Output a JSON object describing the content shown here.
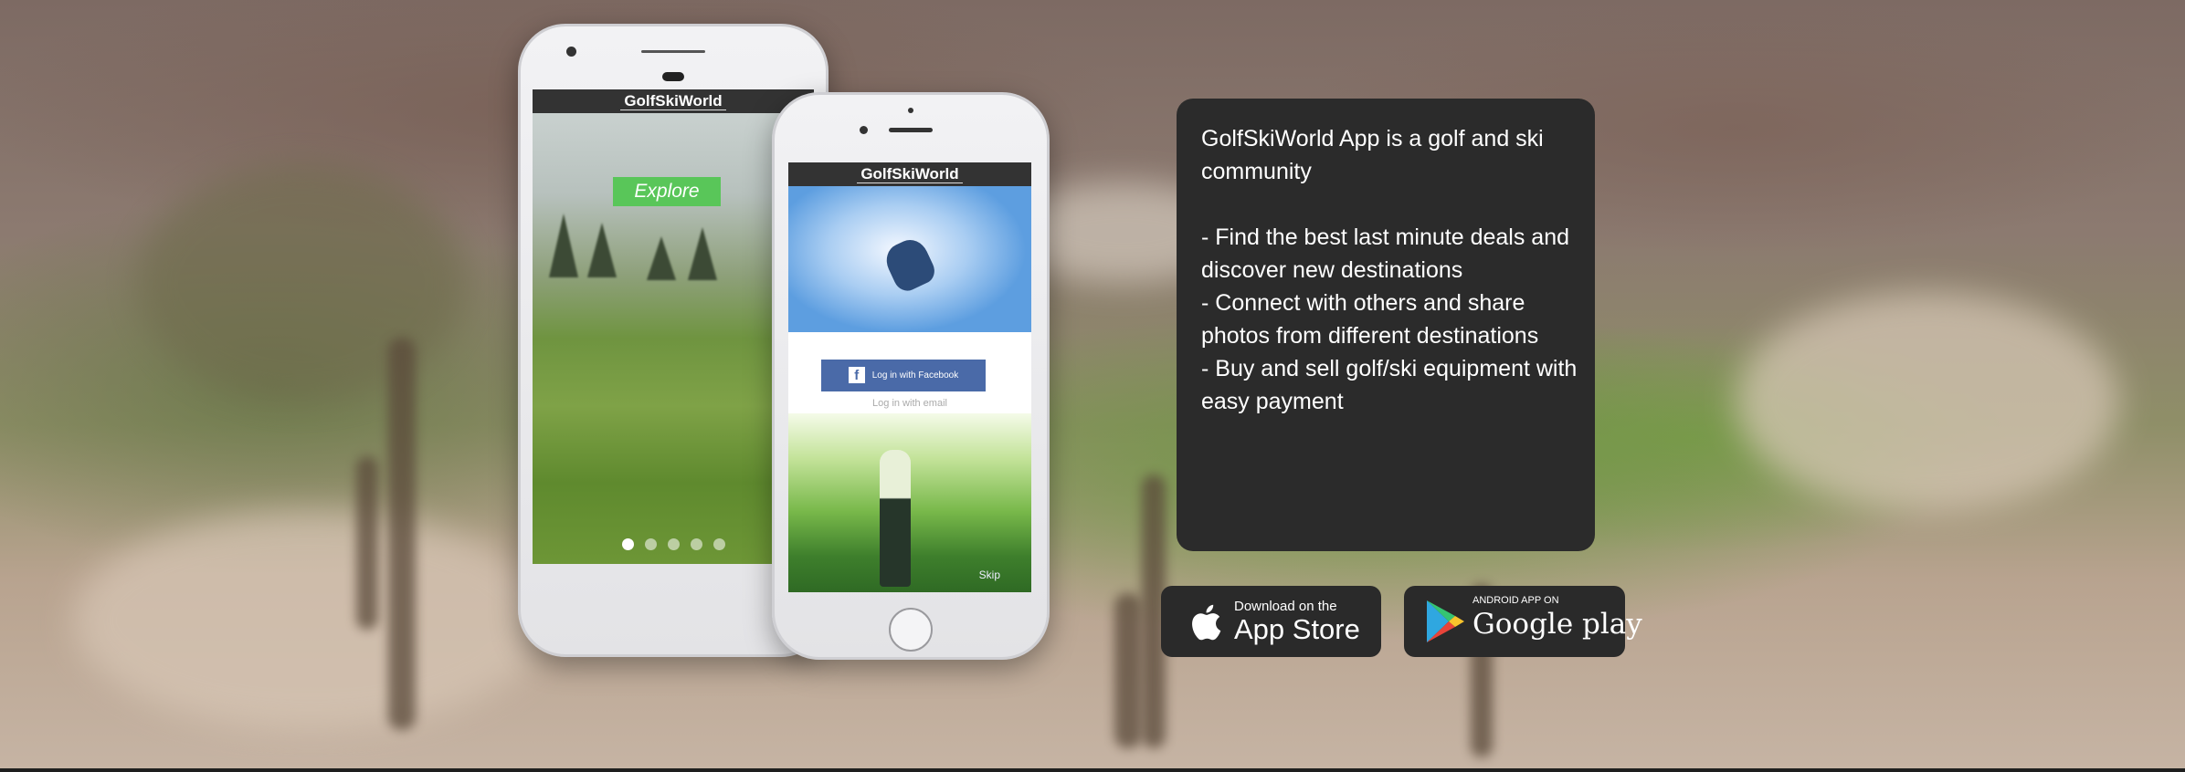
{
  "app_name": "GolfSkiWorld",
  "back_phone": {
    "explore_label": "Explore",
    "dots": [
      true,
      false,
      false,
      false,
      false
    ]
  },
  "front_phone": {
    "facebook_label": "Log in with Facebook",
    "email_label": "Log in with email",
    "skip_label": "Skip"
  },
  "info_card": {
    "intro": "GolfSkiWorld App is a golf and ski community",
    "features": [
      "- Find the best last minute deals and discover new destinations",
      "- Connect with others and share photos from different destinations",
      "- Buy and sell golf/ski  equipment with easy payment"
    ]
  },
  "app_store": {
    "small": "Download on the",
    "big": "App Store",
    "icon": "apple-icon"
  },
  "google_play": {
    "small": "ANDROID APP ON",
    "big": "Google play",
    "icon": "google-play-icon"
  },
  "colors": {
    "card_bg": "#2b2b2b",
    "explore_green": "#59c659",
    "facebook_blue": "#4a6aa8"
  }
}
